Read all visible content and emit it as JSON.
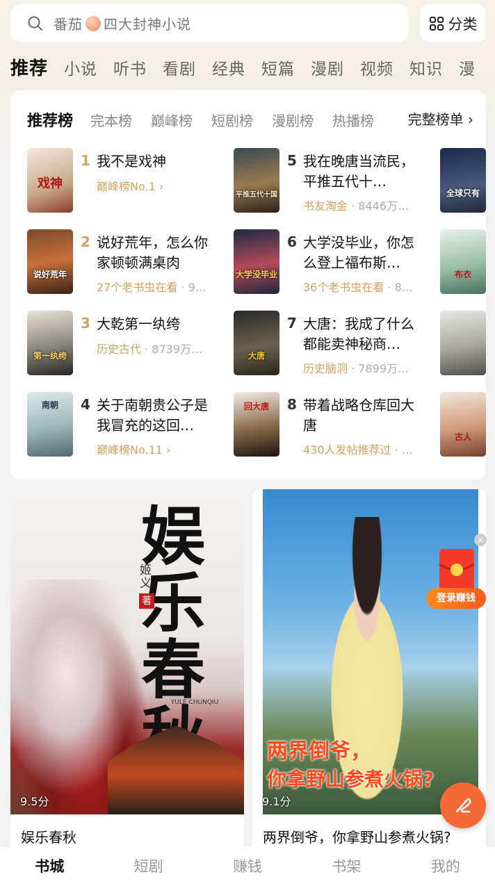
{
  "search": {
    "text_before": "番茄",
    "text_after": "四大封神小说",
    "category_label": "分类"
  },
  "tabs": [
    "推荐",
    "小说",
    "听书",
    "看剧",
    "经典",
    "短篇",
    "漫剧",
    "视频",
    "知识",
    "漫"
  ],
  "rank": {
    "tabs": [
      "推荐榜",
      "完本榜",
      "巅峰榜",
      "短剧榜",
      "漫剧榜",
      "热播榜"
    ],
    "more_label": "完整榜单",
    "books": [
      {
        "num": "1",
        "title": "我不是戏神",
        "meta": "巅峰榜No.1",
        "extra": "",
        "arrow": "›",
        "cover": "戏神"
      },
      {
        "num": "2",
        "title": "说好荒年，怎么你家顿顿满桌肉",
        "meta": "27个老书虫在看",
        "extra": "· 9…",
        "arrow": "",
        "cover": "说好荒年"
      },
      {
        "num": "3",
        "title": "大乾第一纨绔",
        "meta": "历史古代",
        "extra": "· 8739万…",
        "arrow": "",
        "cover": "第一纨绔"
      },
      {
        "num": "4",
        "title": "关于南朝贵公子是我冒充的这回…",
        "meta": "巅峰榜No.11",
        "extra": "",
        "arrow": "›",
        "cover": "南朝"
      },
      {
        "num": "5",
        "title": "我在晚唐当流民，平推五代十…",
        "meta": "书友淘金",
        "extra": "· 8446万…",
        "arrow": "",
        "cover": "平推五代十国"
      },
      {
        "num": "6",
        "title": "大学没毕业，你怎么登上福布斯…",
        "meta": "36个老书虫在看",
        "extra": "· 8…",
        "arrow": "",
        "cover": "大学没毕业"
      },
      {
        "num": "7",
        "title": "大唐：我成了什么都能卖神秘商…",
        "meta": "历史脑洞",
        "extra": "· 7899万…",
        "arrow": "",
        "cover": "大唐"
      },
      {
        "num": "8",
        "title": "带着战略仓库回大唐",
        "meta": "430人发帖推荐过",
        "extra": "· …",
        "arrow": "",
        "cover": "回大唐"
      }
    ],
    "peek_covers": [
      "全球只有",
      "布衣",
      "",
      "古人"
    ]
  },
  "cards": [
    {
      "title": "娱乐春秋",
      "score": "9.5分",
      "poster_big": "娱乐春秋",
      "poster_pinyin": "YULE CHUNQIU",
      "author": "姬义",
      "author_mark": "著"
    },
    {
      "title": "两界倒爷，你拿野山参煮火锅?",
      "score": "9.1分",
      "poster_line1": "两界倒爷，",
      "poster_line2": "你拿野山参煮火锅?"
    }
  ],
  "promo": {
    "login_earn": "登录赚钱",
    "close": "×"
  },
  "bottom_nav": [
    "书城",
    "短剧",
    "赚钱",
    "书架",
    "我的"
  ],
  "colors": {
    "accent": "#f46a35",
    "rank_num_top": "#d7a05c",
    "meta": "#d7a05c"
  }
}
